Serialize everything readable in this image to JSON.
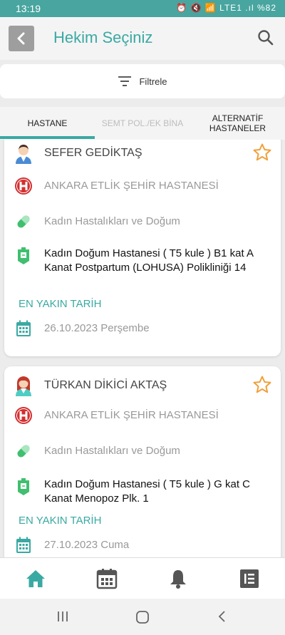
{
  "status": {
    "time": "13:19",
    "icons": "⏰ 🔇 📶 LTE1 .ıl %82",
    "battery": "%82"
  },
  "header": {
    "title": "Hekim Seçiniz"
  },
  "filter": {
    "label": "Filtrele"
  },
  "tabs": [
    {
      "label": "HASTANE"
    },
    {
      "label": "SEMT POL./EK BİNA"
    },
    {
      "label": "ALTERNATİF HASTANELER"
    }
  ],
  "doctors": [
    {
      "name": "SEFER GEDİKTAŞ",
      "hospital": "ANKARA ETLİK ŞEHİR HASTANESİ",
      "department": "Kadın Hastalıkları ve Doğum",
      "location": "Kadın Doğum Hastanesi ( T5 kule ) B1 kat A Kanat  Postpartum (LOHUSA) Polikliniği 14",
      "nearest_label": "EN YAKIN TARİH",
      "date": "26.10.2023 Perşembe"
    },
    {
      "name": "TÜRKAN DİKİCİ AKTAŞ",
      "hospital": "ANKARA ETLİK ŞEHİR HASTANESİ",
      "department": "Kadın Hastalıkları ve Doğum",
      "location": "Kadın Doğum Hastanesi ( T5 kule ) G kat C Kanat Menopoz Plk. 1",
      "nearest_label": "EN YAKIN TARİH",
      "date": "27.10.2023 Cuma"
    }
  ],
  "colors": {
    "accent": "#3aa9a3",
    "star": "#f0a03a",
    "hospital_red": "#d32f2f",
    "pill_green": "#3fbf6f"
  }
}
